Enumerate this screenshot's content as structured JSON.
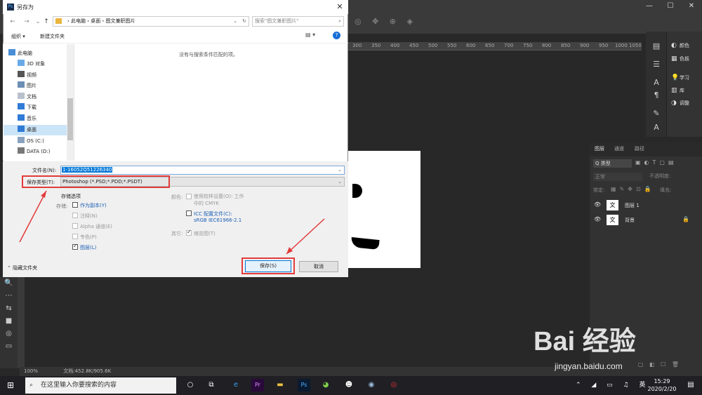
{
  "dialog": {
    "title": "另存为",
    "close": "✕",
    "nav": {
      "back": "←",
      "forward": "→",
      "down": "⌄",
      "up": "↑"
    },
    "breadcrumb": "› 此电脑 › 桌面 › 图文兼职图片",
    "search_placeholder": "搜索\"图文兼职图片\"",
    "organize": "组织 ▾",
    "new_folder": "新建文件夹",
    "view_icon": "▤ ▾",
    "help": "?",
    "nav_items": [
      "此电脑",
      "3D 对象",
      "视频",
      "图片",
      "文档",
      "下载",
      "音乐",
      "桌面",
      "OS (C:)",
      "DATA (D:)"
    ],
    "empty_message": "没有与搜索条件匹配的项。",
    "filename_label": "文件名(N):",
    "filename_value": "1-16052Q51226340",
    "filetype_label": "保存类型(T):",
    "filetype_value": "Photoshop (*.PSD;*.PDD;*.PSDT)",
    "save_options_title": "存储选项",
    "save_label": "存储:",
    "opt_as_copy": "作为副本(Y)",
    "opt_notes": "注释(N)",
    "opt_alpha": "Alpha 通道(E)",
    "opt_spot": "专色(P)",
    "opt_layers": "图层(L)",
    "color_label": "颜色:",
    "opt_proof": "使用校样设置(O): 工作中的 CMYK",
    "opt_icc": "ICC 配置文件(C):",
    "icc_profile": "sRGB IEC61966-2.1",
    "other_label": "其它:",
    "opt_thumb": "缩览图(T)",
    "hide_folders": "隐藏文件夹",
    "save_button": "保存(S)",
    "cancel_button": "取消"
  },
  "photoshop": {
    "window_controls": [
      "—",
      "☐",
      "✕"
    ],
    "ruler_ticks": [
      "300",
      "350",
      "400",
      "450",
      "500",
      "550",
      "600",
      "650",
      "700",
      "750",
      "800",
      "850",
      "900",
      "950",
      "1000",
      "1050"
    ],
    "zoom": "100%",
    "doc_info": "文档:452.8K/905.6K",
    "dock": [
      {
        "icon": "◐",
        "label": "颜色"
      },
      {
        "icon": "▦",
        "label": "色板"
      },
      {
        "icon": "💡",
        "label": "学习"
      },
      {
        "icon": "▥",
        "label": "库"
      },
      {
        "icon": "◑",
        "label": "调整"
      }
    ],
    "layers_tabs": [
      "图层",
      "通道",
      "路径"
    ],
    "layer_filter": "Q 类型",
    "blend_mode": "正常",
    "opacity_label": "不透明度:",
    "lock_label": "锁定:",
    "fill_label": "填充:",
    "layers": [
      {
        "thumb": "文",
        "name": "图层 1"
      },
      {
        "thumb": "文",
        "name": "背景"
      }
    ]
  },
  "taskbar": {
    "search_placeholder": "在这里输入你要搜索的内容",
    "ime": "英",
    "time": "15:29",
    "date": "2020/2/20"
  },
  "watermark": {
    "text": "Bai 经验",
    "url": "jingyan.baidu.com"
  }
}
